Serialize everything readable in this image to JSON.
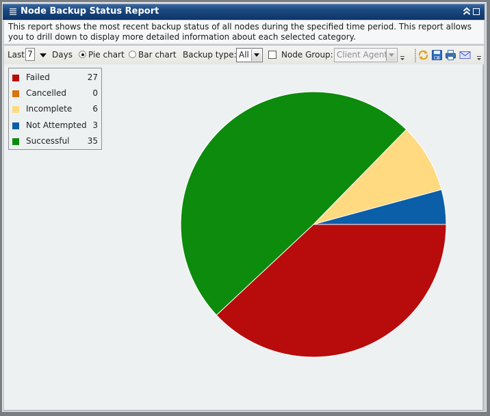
{
  "window": {
    "title": "Node Backup Status Report",
    "description": "This report shows the most recent backup status of all nodes during the specified time period. This report allows you to drill down to display more detailed information about each selected category."
  },
  "toolbar": {
    "last_label": "Last",
    "days_value": "7",
    "days_label": "Days",
    "chart_type_options": [
      {
        "label": "Pie chart",
        "selected": true
      },
      {
        "label": "Bar chart",
        "selected": false
      }
    ],
    "backup_type_label": "Backup type:",
    "backup_type_value": "All",
    "node_group_checked": false,
    "node_group_label": "Node Group:",
    "node_group_value": "Client Agent",
    "node_group_disabled": true,
    "actions": [
      {
        "name": "refresh",
        "icon": "refresh-icon"
      },
      {
        "name": "save",
        "icon": "save-icon"
      },
      {
        "name": "print",
        "icon": "print-icon"
      },
      {
        "name": "email",
        "icon": "email-icon"
      }
    ]
  },
  "chart_data": {
    "type": "pie",
    "title": "",
    "categories": [
      "Failed",
      "Cancelled",
      "Incomplete",
      "Not Attempted",
      "Successful"
    ],
    "values": [
      27,
      0,
      6,
      3,
      35
    ],
    "colors": [
      "#b80c0c",
      "#d9730a",
      "#ffda80",
      "#0b5ea8",
      "#0c8b0c"
    ],
    "slice_order": [
      "Failed",
      "Successful",
      "Incomplete",
      "Not Attempted"
    ],
    "start": "3 o'clock",
    "direction": "clockwise",
    "legend": "top-left"
  }
}
